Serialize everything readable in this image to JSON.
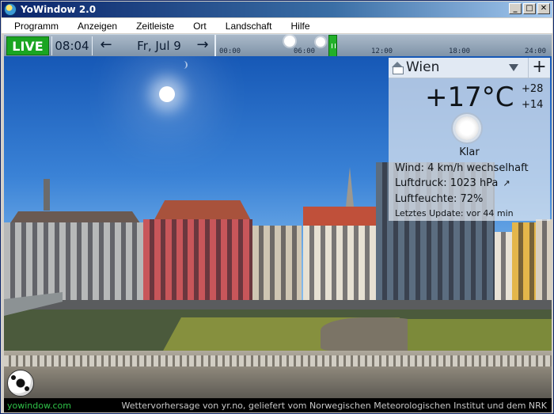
{
  "window": {
    "title": "YoWindow 2.0",
    "controls": {
      "minimize": "_",
      "maximize": "□",
      "close": "✕"
    }
  },
  "menu": {
    "items": [
      "Programm",
      "Anzeigen",
      "Zeitleiste",
      "Ort",
      "Landschaft",
      "Hilfe"
    ]
  },
  "timeline": {
    "live_label": "LIVE",
    "time": "08:04",
    "prev_arrow": "←",
    "date": "Fr, Jul 9",
    "next_arrow": "→",
    "ticks": [
      "00:00",
      "06:00",
      "12:00",
      "18:00",
      "24:00"
    ],
    "accent_color": "#1aa521"
  },
  "weather": {
    "location": "Wien",
    "add_label": "+",
    "temperature": "+17°C",
    "temp_max": "+28",
    "temp_min": "+14",
    "condition": "Klar",
    "wind": "Wind:  4 km/h wechselhaft",
    "pressure": "Luftdruck:  1023 hPa",
    "pressure_trend": "↗",
    "humidity": "Luftfeuchte:  72%",
    "last_update": "Letztes Update:  vor 44 min",
    "condition_icon": "sun-icon"
  },
  "status": {
    "brand": "yowindow.com",
    "credit": "Wettervorhersage von yr.no, geliefert vom Norwegischen Meteorologischen Institut und dem NRK"
  }
}
